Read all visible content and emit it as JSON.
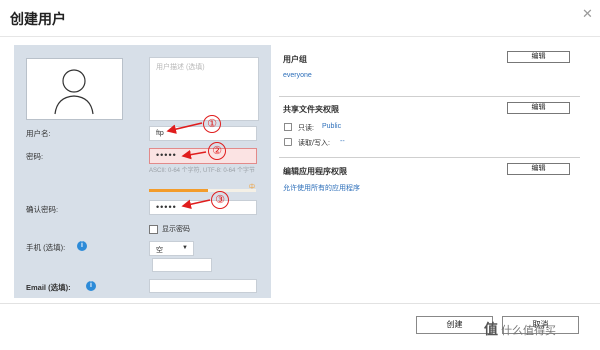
{
  "dialog": {
    "title": "创建用户"
  },
  "user_form": {
    "description_placeholder": "用户描述 (选填)",
    "username_label": "用户名:",
    "username_value": "ftp",
    "password_label": "密码:",
    "password_value": "•••••",
    "password_hint": "ASCII: 0-64 个字符, UTF-8: 0-64 个字节",
    "password_strength": "中",
    "password_strength_level": 0.55,
    "confirm_label": "确认密码:",
    "confirm_value": "•••••",
    "show_password_label": "显示密码",
    "show_password_checked": false,
    "phone_label": "手机 (选填):",
    "country_select": "空",
    "email_label": "Email (选填):"
  },
  "user_group": {
    "title": "用户组",
    "edit_label": "编辑",
    "value": "everyone"
  },
  "shared_folders": {
    "title": "共享文件夹权限",
    "edit_label": "编辑",
    "readonly_label": "只读:",
    "readonly_value": "Public",
    "readwrite_label": "读取/写入:",
    "readwrite_value": "--"
  },
  "app_permissions": {
    "title": "编辑应用程序权限",
    "edit_label": "编辑",
    "value": "允许使用所有的应用程序"
  },
  "footer": {
    "create_label": "创建",
    "cancel_label": "取消"
  },
  "annotations": [
    "①",
    "②",
    "③"
  ],
  "watermark": {
    "big": "值",
    "text": "什么值得买"
  },
  "colors": {
    "panel": "#d7dfe8",
    "accent_link": "#2d6fba",
    "annotation": "#e01d1d",
    "strength": "#f39c2b"
  }
}
